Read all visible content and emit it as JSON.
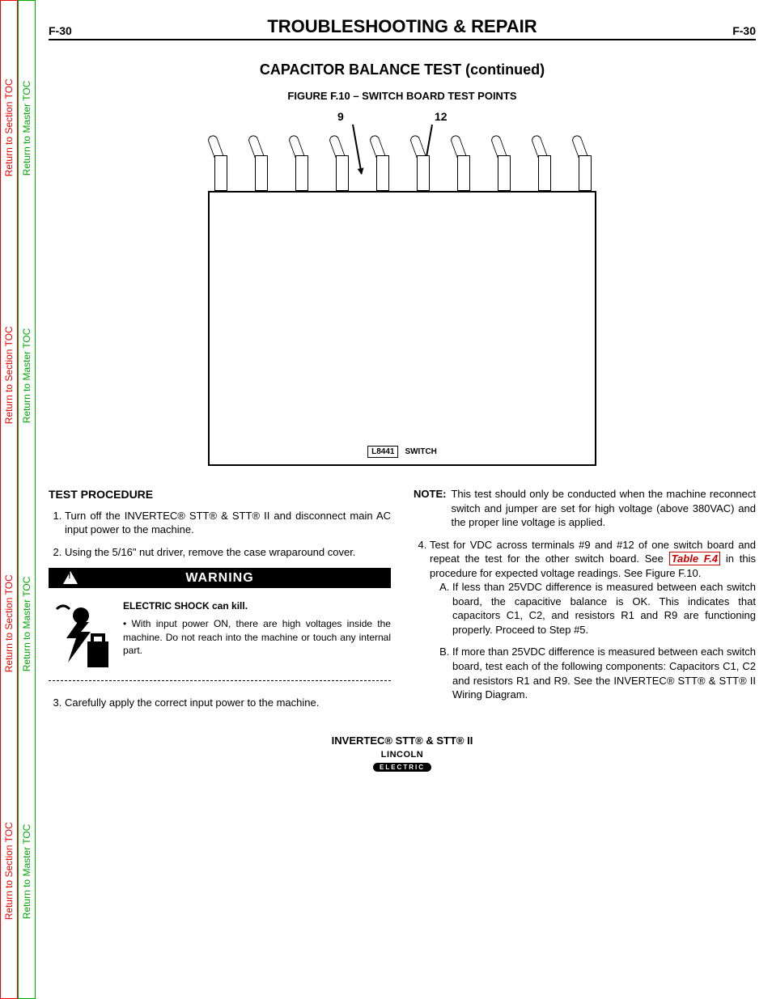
{
  "sideTabs": {
    "red": [
      "Return to Section TOC",
      "Return to Section TOC",
      "Return to Section TOC",
      "Return to Section TOC"
    ],
    "green": [
      "Return to Master TOC",
      "Return to Master TOC",
      "Return to Master TOC",
      "Return to Master TOC"
    ]
  },
  "header": {
    "pageLeft": "F-30",
    "pageRight": "F-30",
    "title": "TROUBLESHOOTING & REPAIR"
  },
  "subtitle": "CAPACITOR BALANCE TEST  (continued)",
  "figure": {
    "caption": "FIGURE F.10 – SWITCH BOARD TEST POINTS",
    "callout9": "9",
    "callout12": "12",
    "boardLabelBox": "L8441",
    "boardLabelText": "SWITCH"
  },
  "leftCol": {
    "heading": "TEST PROCEDURE",
    "step1": "Turn off the INVERTEC® STT® & STT® II and disconnect main AC input power to the machine.",
    "step2": "Using the 5/16\" nut driver, remove the case wraparound cover.",
    "warningBar": "WARNING",
    "warnLead": "ELECTRIC SHOCK can kill.",
    "warnBullet": "With input power ON, there are high voltages inside the machine.  Do not reach into the machine or touch any internal part.",
    "step3": "Carefully apply the correct input power to the machine."
  },
  "rightCol": {
    "noteLabel": "NOTE:",
    "noteText": "This test should only be conducted when the machine reconnect switch and jumper are set for high voltage (above 380VAC) and the proper line voltage is applied.",
    "step4a": "Test for VDC across terminals #9 and #12 of one switch board and repeat the test for the other switch board.  See ",
    "tableLink": "Table F.4",
    "step4b": " in this procedure for expected voltage readings. See Figure F.10.",
    "subA": "If less than 25VDC difference is measured between each switch board, the capacitive balance is OK.  This indicates that capacitors C1, C2, and resistors R1 and R9 are functioning properly.  Proceed to Step #5.",
    "subB": "If more than 25VDC difference is measured between each switch board, test each of the following components: Capacitors C1, C2 and resistors R1 and R9.  See the INVERTEC® STT® & STT® II Wiring Diagram."
  },
  "footer": {
    "product": "INVERTEC® STT® & STT® II",
    "logoTop": "LINCOLN",
    "logoBot": "ELECTRIC"
  }
}
